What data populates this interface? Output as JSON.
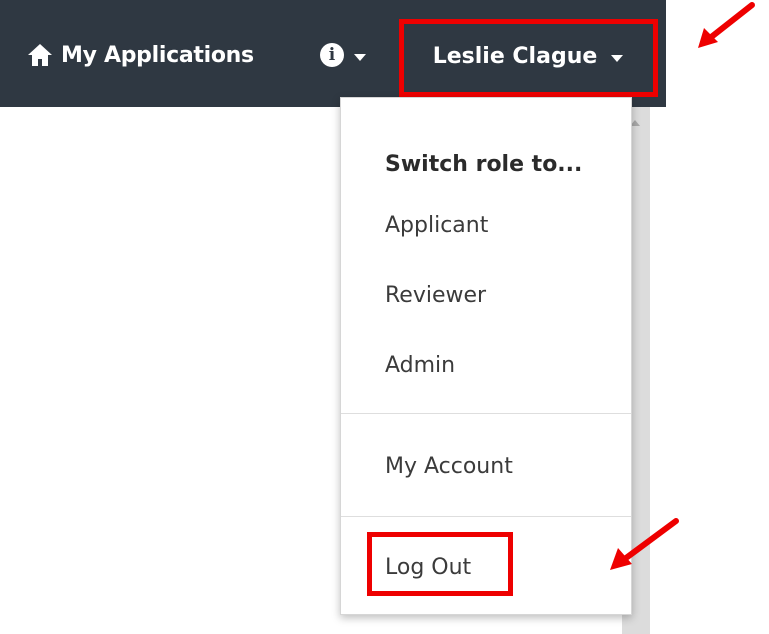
{
  "navbar": {
    "home_label": "My Applications",
    "user_name": "Leslie Clague"
  },
  "dropdown": {
    "heading": "Switch role to...",
    "roles": [
      "Applicant",
      "Reviewer",
      "Admin"
    ],
    "account_label": "My Account",
    "logout_label": "Log Out"
  },
  "colors": {
    "navbar_bg": "#2f3842",
    "highlight": "#ee0000"
  },
  "icons": [
    "home-icon",
    "info-icon",
    "chevron-down-icon"
  ]
}
